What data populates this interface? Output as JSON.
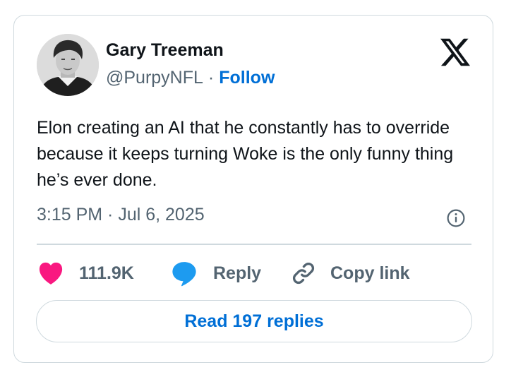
{
  "author": {
    "name": "Gary Treeman",
    "handle": "@PurpyNFL",
    "separator": "·",
    "follow_label": "Follow"
  },
  "tweet": {
    "text": "Elon creating an AI that he constantly has to override because it keeps turning Woke is the only funny thing he’s ever done.",
    "timestamp": "3:15 PM · Jul 6, 2025"
  },
  "actions": {
    "likes": "111.9K",
    "reply_label": "Reply",
    "copy_label": "Copy link"
  },
  "read_replies_label": "Read 197 replies",
  "icons": {
    "brand": "x-logo-icon",
    "info": "info-icon",
    "like": "heart-icon",
    "reply": "speech-bubble-icon",
    "copy": "link-icon"
  },
  "colors": {
    "heart": "#f91880",
    "reply_bubble": "#1d9bf0",
    "link_blue": "#006fd6",
    "muted": "#536471",
    "text": "#0f1419",
    "border": "#cfd9de"
  }
}
